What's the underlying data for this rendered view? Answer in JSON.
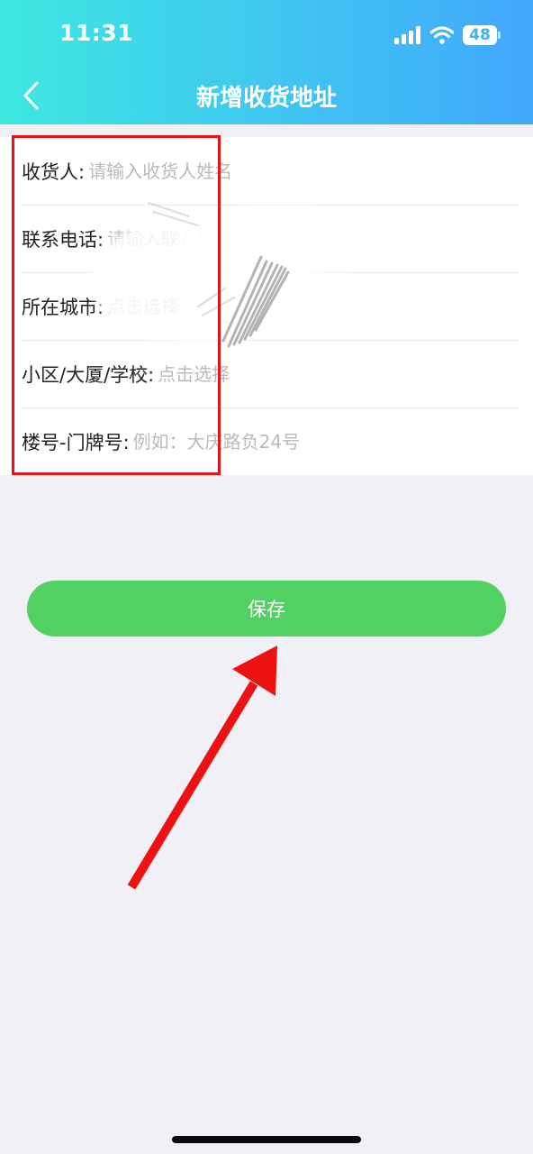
{
  "status_bar": {
    "time": "11:31",
    "battery": "48",
    "icons": [
      "signal-icon",
      "wifi-icon",
      "battery-icon"
    ]
  },
  "header": {
    "title": "新增收货地址",
    "back_icon": "chevron-left-icon"
  },
  "form": {
    "rows": [
      {
        "label": "收货人:",
        "placeholder": "请输入收货人姓名"
      },
      {
        "label": "联系电话:",
        "placeholder": "请输入联系电话"
      },
      {
        "label": "所在城市:",
        "placeholder": "点击选择"
      },
      {
        "label": "小区/大厦/学校:",
        "placeholder": "点击选择"
      },
      {
        "label": "楼号-门牌号:",
        "placeholder": "例如：大庆路负24号"
      }
    ]
  },
  "actions": {
    "save_label": "保存"
  },
  "colors": {
    "header_gradient_start": "#3ee8e0",
    "header_gradient_end": "#42a8fb",
    "save_button": "#51d162",
    "annotation_red": "#e8121b",
    "page_background": "#f1f0f6"
  }
}
